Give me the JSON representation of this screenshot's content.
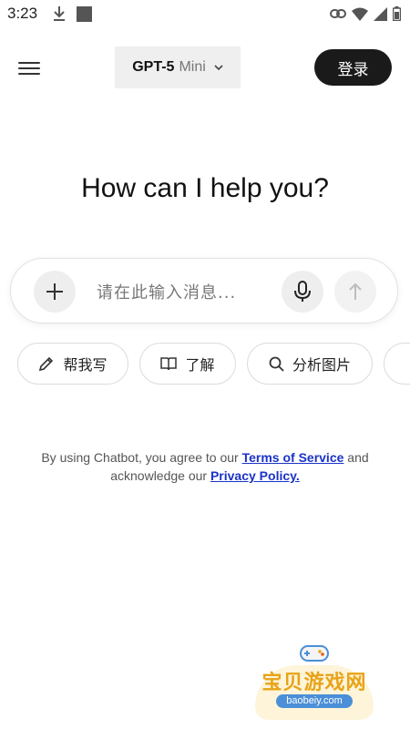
{
  "status_bar": {
    "time": "3:23",
    "icons": [
      "download-icon",
      "app-square-icon",
      "link-icon",
      "wifi-icon",
      "signal-icon",
      "battery-icon"
    ]
  },
  "header": {
    "menu_icon": "hamburger-menu-icon",
    "model_name": "GPT-5",
    "model_variant": "Mini",
    "login_label": "登录"
  },
  "main": {
    "heading": "How can I help you?"
  },
  "composer": {
    "placeholder": "请在此输入消息...",
    "value": "",
    "icons": {
      "add": "plus-icon",
      "mic": "microphone-icon",
      "send": "arrow-up-icon"
    }
  },
  "chips": [
    {
      "label": "帮我写",
      "icon": "pencil-icon"
    },
    {
      "label": "了解",
      "icon": "book-icon"
    },
    {
      "label": "分析图片",
      "icon": "search-icon"
    }
  ],
  "terms": {
    "prefix": "By using Chatbot, you agree to our ",
    "tos_link": "Terms of Service",
    "middle": " and acknowledge our ",
    "privacy_link": "Privacy Policy."
  },
  "watermark": {
    "title": "宝贝游戏网",
    "url": "baobeiy.com"
  },
  "colors": {
    "accent_dark": "#1a1a1a",
    "link": "#1a33c8",
    "chip_border": "#dcdcdc",
    "watermark_gold": "#e8a317"
  }
}
